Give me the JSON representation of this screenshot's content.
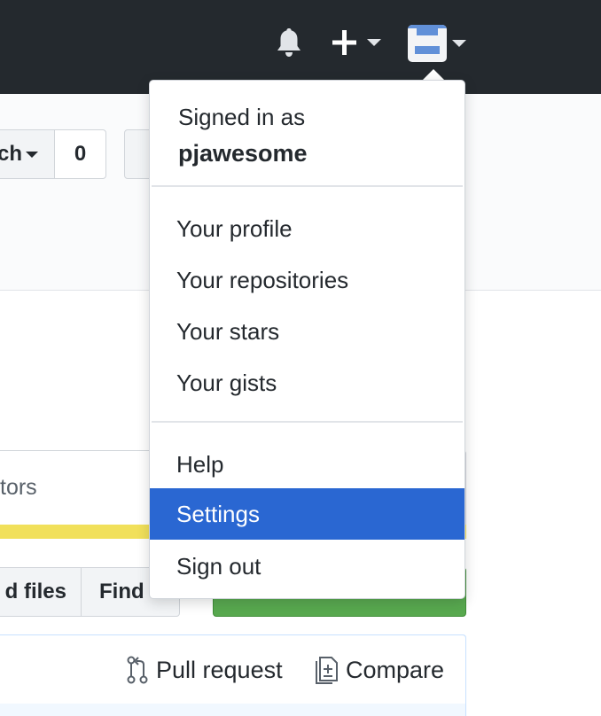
{
  "header": {
    "bell_icon": "bell-icon",
    "new_icon": "plus-icon",
    "avatar_icon": "avatar-icon",
    "colors": {
      "background": "#24292e",
      "avatar": "#6190d8"
    }
  },
  "repo": {
    "branch_button_label": "ch",
    "count_value": "0",
    "contributors_label": "tors",
    "upload_button_label": "d files",
    "find_button_label": "Find",
    "pull_request_label": "Pull request",
    "compare_label": "Compare",
    "language_color": "#f1e05a",
    "clone_button_color": "#58a94f"
  },
  "dropdown": {
    "signed_in_label": "Signed in as",
    "username": "pjawesome",
    "items": [
      {
        "label": "Your profile"
      },
      {
        "label": "Your repositories"
      },
      {
        "label": "Your stars"
      },
      {
        "label": "Your gists"
      },
      {
        "label": "Help"
      },
      {
        "label": "Settings",
        "active": true
      },
      {
        "label": "Sign out"
      }
    ],
    "active_color": "#2a67d2"
  }
}
